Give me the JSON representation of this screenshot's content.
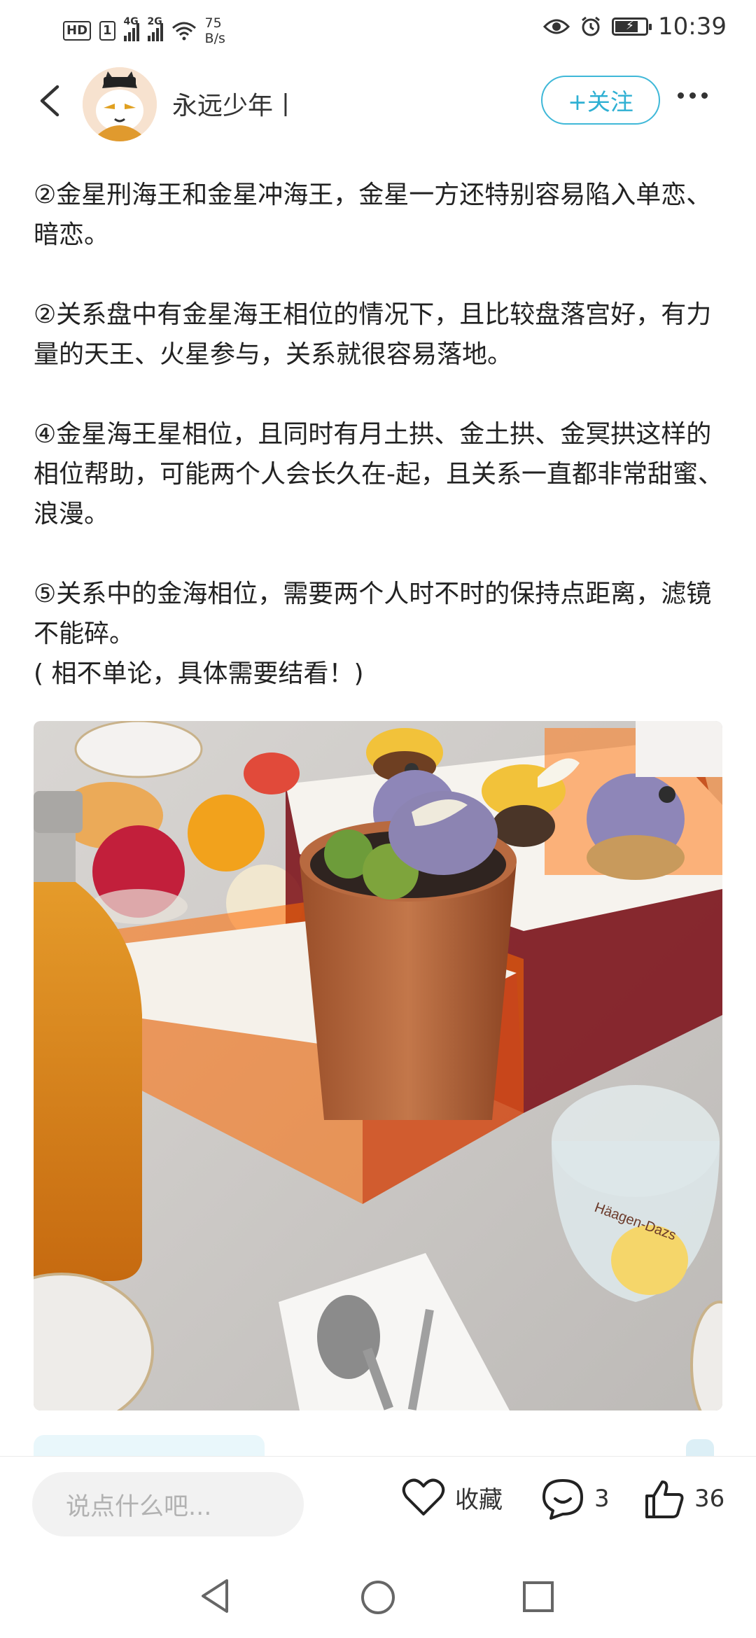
{
  "status_bar": {
    "hd_label": "HD",
    "sim_label": "1",
    "net1": "4G",
    "net2": "2G",
    "speed_value": "75",
    "speed_unit": "B/s",
    "time": "10:39"
  },
  "header": {
    "author_name": "永远少年丨",
    "follow_label": "+关注"
  },
  "article": {
    "paragraphs": [
      "②金星刑海王和金星冲海王，金星一方还特别容易陷入单恋、暗恋。",
      "②关系盘中有金星海王相位的情况下，且比较盘落宫好，有力量的天王、火星参与，关系就很容易落地。",
      "④金星海王星相位，且同时有月土拱、金土拱、金冥拱这样的相位帮助，可能两个人会长久在-起，且关系一直都非常甜蜜、浪漫。",
      "⑤关系中的金海相位，需要两个人时不时的保持点距离，滤镜不能碎。",
      "( 相不单论，具体需要结看！)"
    ]
  },
  "photo": {
    "cup_brand": "Häagen-Dazs"
  },
  "bottom_bar": {
    "comment_placeholder": "说点什么吧...",
    "collect_label": "收藏",
    "comment_count": "3",
    "like_count": "36"
  },
  "colors": {
    "accent": "#2fb0d3",
    "text": "#222222",
    "muted": "#b2b2b2"
  },
  "icons": [
    "back-icon",
    "more-icon",
    "heart-icon",
    "comment-icon",
    "like-icon",
    "nav-back-icon",
    "nav-home-icon",
    "nav-recent-icon",
    "eye-icon",
    "alarm-icon",
    "wifi-icon",
    "battery-icon"
  ]
}
